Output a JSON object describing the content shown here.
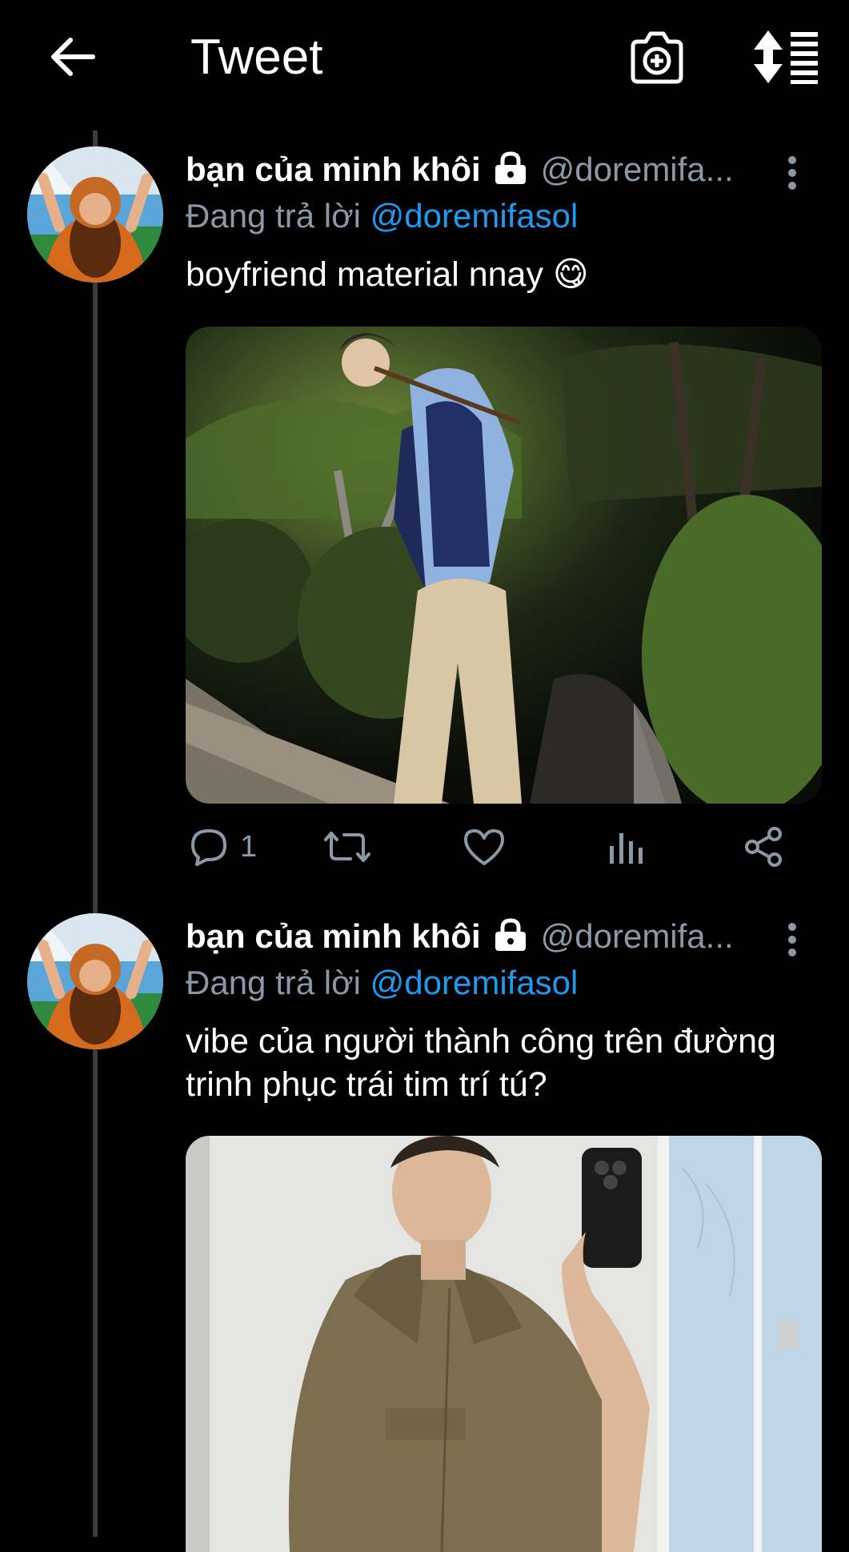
{
  "header": {
    "title": "Tweet",
    "back_icon": "arrow-left-icon",
    "camera_icon": "camera-add-icon",
    "sort_icon": "sort-icon"
  },
  "colors": {
    "background": "#000000",
    "link": "#1d9bf0",
    "muted": "#8b98a5"
  },
  "tweets": [
    {
      "display_name": "bạn của minh khôi",
      "handle": "@doremifa...",
      "reply_label": "Đang trả lời",
      "reply_to": "@doremifasol",
      "text": "boyfriend material nnay 😋",
      "actions": {
        "reply_count": "1",
        "retweet_count": "",
        "like_count": ""
      }
    },
    {
      "display_name": "bạn của minh khôi",
      "handle": "@doremifa...",
      "reply_label": "Đang trả lời",
      "reply_to": "@doremifasol",
      "text": "vibe của người thành công trên đường trinh phục trái tim trí tú?"
    }
  ]
}
